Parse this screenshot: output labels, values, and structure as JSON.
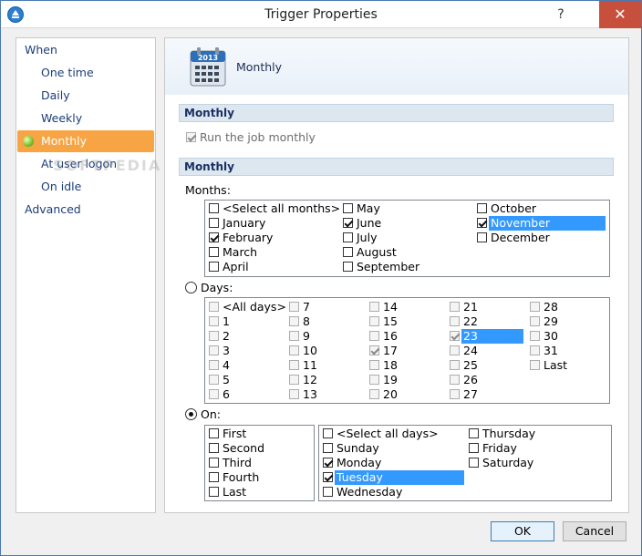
{
  "window": {
    "title": "Trigger Properties",
    "help_label": "?",
    "close_label": "✕"
  },
  "nav": {
    "items": [
      {
        "label": "When"
      },
      {
        "label": "One time"
      },
      {
        "label": "Daily"
      },
      {
        "label": "Weekly"
      },
      {
        "label": "Monthly"
      },
      {
        "label": "At user logon"
      },
      {
        "label": "On idle"
      },
      {
        "label": "Advanced"
      }
    ],
    "selected": "Monthly"
  },
  "banner": {
    "title": "Monthly",
    "icon": "calendar-2013-icon",
    "icon_year": "2013"
  },
  "section1": {
    "title": "Monthly",
    "run_label": "Run the job monthly",
    "run_checked": true
  },
  "section2": {
    "title": "Monthly",
    "months_label": "Months:",
    "months": [
      {
        "label": "<Select all months>",
        "checked": false
      },
      {
        "label": "January",
        "checked": false
      },
      {
        "label": "February",
        "checked": true
      },
      {
        "label": "March",
        "checked": false
      },
      {
        "label": "April",
        "checked": false
      },
      {
        "label": "May",
        "checked": false
      },
      {
        "label": "June",
        "checked": true
      },
      {
        "label": "July",
        "checked": false
      },
      {
        "label": "August",
        "checked": false
      },
      {
        "label": "September",
        "checked": false
      },
      {
        "label": "October",
        "checked": false
      },
      {
        "label": "November",
        "checked": true,
        "selected": true
      },
      {
        "label": "December",
        "checked": false
      }
    ],
    "days_label": "Days:",
    "days": [
      {
        "label": "<All days>",
        "checked": false
      },
      {
        "label": "1",
        "checked": false
      },
      {
        "label": "2",
        "checked": false
      },
      {
        "label": "3",
        "checked": false
      },
      {
        "label": "4",
        "checked": false
      },
      {
        "label": "5",
        "checked": false
      },
      {
        "label": "6",
        "checked": false
      },
      {
        "label": "7",
        "checked": false
      },
      {
        "label": "8",
        "checked": false
      },
      {
        "label": "9",
        "checked": false
      },
      {
        "label": "10",
        "checked": false
      },
      {
        "label": "11",
        "checked": false
      },
      {
        "label": "12",
        "checked": false
      },
      {
        "label": "13",
        "checked": false
      },
      {
        "label": "14",
        "checked": false
      },
      {
        "label": "15",
        "checked": false
      },
      {
        "label": "16",
        "checked": false
      },
      {
        "label": "17",
        "checked": true
      },
      {
        "label": "18",
        "checked": false
      },
      {
        "label": "19",
        "checked": false
      },
      {
        "label": "20",
        "checked": false
      },
      {
        "label": "21",
        "checked": false
      },
      {
        "label": "22",
        "checked": false
      },
      {
        "label": "23",
        "checked": true,
        "selected": true
      },
      {
        "label": "24",
        "checked": false
      },
      {
        "label": "25",
        "checked": false
      },
      {
        "label": "26",
        "checked": false
      },
      {
        "label": "27",
        "checked": false
      },
      {
        "label": "28",
        "checked": false
      },
      {
        "label": "29",
        "checked": false
      },
      {
        "label": "30",
        "checked": false
      },
      {
        "label": "31",
        "checked": false
      },
      {
        "label": "Last",
        "checked": false
      }
    ],
    "on_label": "On:",
    "mode": "on",
    "occurrences": [
      {
        "label": "First",
        "checked": false
      },
      {
        "label": "Second",
        "checked": false
      },
      {
        "label": "Third",
        "checked": false
      },
      {
        "label": "Fourth",
        "checked": false
      },
      {
        "label": "Last",
        "checked": false
      }
    ],
    "weekdays": [
      {
        "label": "<Select all days>",
        "checked": false
      },
      {
        "label": "Sunday",
        "checked": false
      },
      {
        "label": "Monday",
        "checked": true
      },
      {
        "label": "Tuesday",
        "checked": true,
        "selected": true
      },
      {
        "label": "Wednesday",
        "checked": false
      },
      {
        "label": "Thursday",
        "checked": false
      },
      {
        "label": "Friday",
        "checked": false
      },
      {
        "label": "Saturday",
        "checked": false
      }
    ]
  },
  "buttons": {
    "ok": "OK",
    "cancel": "Cancel"
  },
  "watermark": "SOFTPEDIA",
  "colors": {
    "selection": "#3399ff",
    "nav_selected": "#f7a444",
    "close_button": "#c7503d",
    "section_bg": "#dde7f0"
  }
}
